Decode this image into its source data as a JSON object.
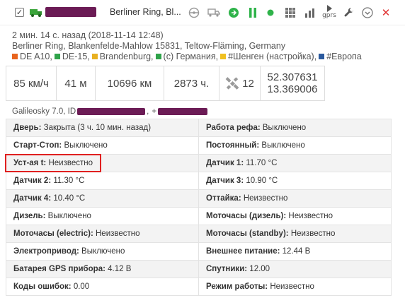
{
  "header": {
    "checkbox_mark": "✓",
    "location_short": "Berliner Ring, Bl...",
    "gprs_label": "gprs",
    "close_glyph": "✕",
    "colors": {
      "accent_green": "#2fb34a",
      "close_red": "#e03030",
      "redaction": "#6b1b55"
    }
  },
  "info": {
    "time_ago": "2 мин. 14 с. назад (2018-11-14 12:48)",
    "address": "Berliner Ring, Blankenfelde-Mahlow 15831, Teltow-Fläming, Germany",
    "geozones": [
      {
        "label": "DE A10,",
        "color": "#e8641e"
      },
      {
        "label": "DE-15,",
        "color": "#2fa34a"
      },
      {
        "label": "Brandenburg,",
        "color": "#e8b020"
      },
      {
        "label": "(c) Германия,",
        "color": "#2fa34a"
      },
      {
        "label": "#Шенген (настройка),",
        "color": "#f0c020"
      },
      {
        "label": "#Европа",
        "color": "#2b5a9e"
      }
    ]
  },
  "metrics": {
    "speed": "85 км/ч",
    "altitude": "41 м",
    "mileage": "10696 км",
    "engine_hours": "2873 ч.",
    "satellites": "12",
    "lat": "52.307631",
    "lon": "13.369006"
  },
  "device": {
    "label_start": "Galileosky 7.0, ID",
    "separator": ",",
    "phone_prefix": "+"
  },
  "params": [
    [
      {
        "label": "Дверь:",
        "value": "Закрыта (3 ч. 10 мин. назад)"
      },
      {
        "label": "Работа рефа:",
        "value": "Выключено"
      }
    ],
    [
      {
        "label": "Старт-Стоп:",
        "value": "Выключено"
      },
      {
        "label": "Постоянный:",
        "value": "Выключено"
      }
    ],
    [
      {
        "label": "Уст-ая t:",
        "value": "Неизвестно"
      },
      {
        "label": "Датчик 1:",
        "value": "11.70 °C"
      }
    ],
    [
      {
        "label": "Датчик 2:",
        "value": "11.30 °C"
      },
      {
        "label": "Датчик 3:",
        "value": "10.90 °C"
      }
    ],
    [
      {
        "label": "Датчик 4:",
        "value": "10.40 °C"
      },
      {
        "label": "Оттайка:",
        "value": "Неизвестно"
      }
    ],
    [
      {
        "label": "Дизель:",
        "value": "Выключено"
      },
      {
        "label": "Моточасы (дизель):",
        "value": "Неизвестно"
      }
    ],
    [
      {
        "label": "Моточасы (electric):",
        "value": "Неизвестно"
      },
      {
        "label": "Моточасы (standby):",
        "value": "Неизвестно"
      }
    ],
    [
      {
        "label": "Электропривод:",
        "value": "Выключено"
      },
      {
        "label": "Внешнее питание:",
        "value": "12.44 В"
      }
    ],
    [
      {
        "label": "Батарея GPS прибора:",
        "value": "4.12 В"
      },
      {
        "label": "Спутники:",
        "value": "12.00"
      }
    ],
    [
      {
        "label": "Коды ошибок:",
        "value": "0.00"
      },
      {
        "label": "Режим работы:",
        "value": "Неизвестно"
      }
    ]
  ]
}
